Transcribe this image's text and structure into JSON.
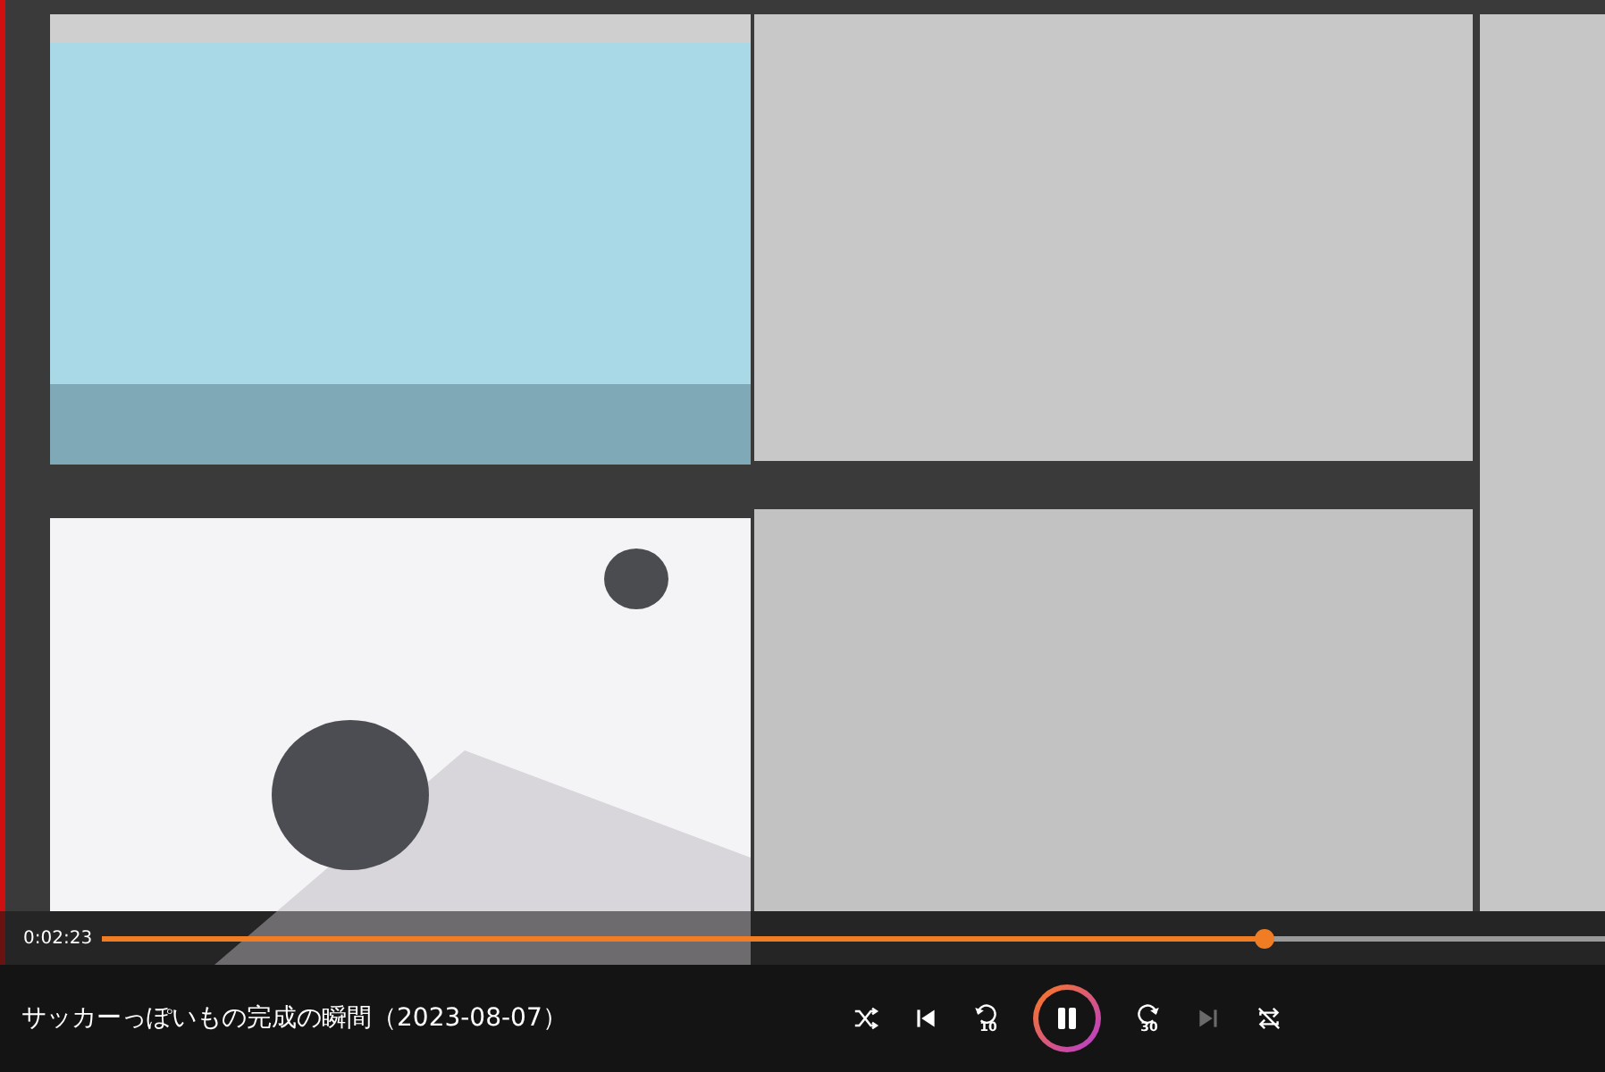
{
  "progress": {
    "time": "0:02:23",
    "level": 0.773
  },
  "title": "サッカーっぽいもの完成の瞬間（2023-08-07）",
  "controls": [
    {
      "kind": "shuffle",
      "disabled": false
    },
    {
      "kind": "previous",
      "disabled": false
    },
    {
      "kind": "rewind",
      "label": "10",
      "disabled": false
    },
    {
      "kind": "pause",
      "disabled": false
    },
    {
      "kind": "forward",
      "label": "30",
      "disabled": false
    },
    {
      "kind": "next",
      "disabled": true
    },
    {
      "kind": "repeat",
      "disabled": false
    }
  ]
}
